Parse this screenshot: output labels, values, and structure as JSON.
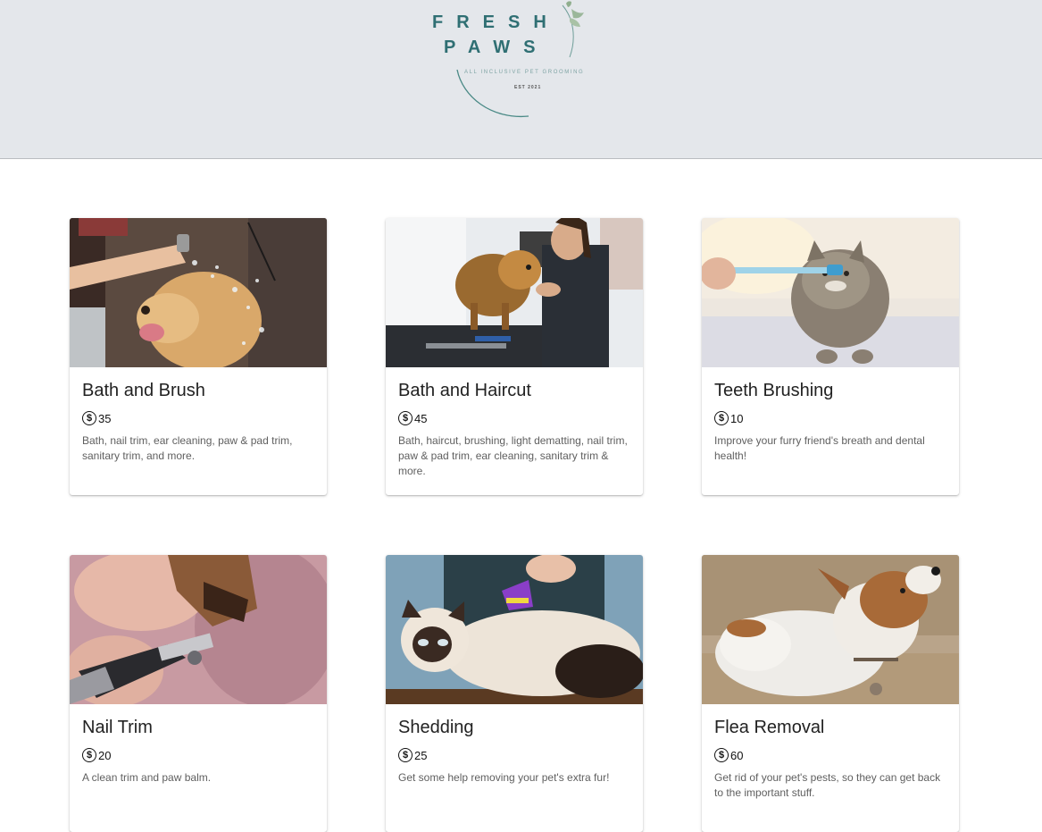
{
  "header": {
    "logo": {
      "line1": "FRESH",
      "line2": "PAWS",
      "tagline": "All inclusive pet grooming",
      "est": "EST 2021"
    },
    "background": "#e4e7eb",
    "brand_color": "#2f6f73"
  },
  "services": [
    {
      "title": "Bath and Brush",
      "price": "35",
      "description": "Bath, nail trim, ear cleaning, paw & pad trim, sanitary trim, and more.",
      "image": "dog-bath-photo"
    },
    {
      "title": "Bath and Haircut",
      "price": "45",
      "description": "Bath, haircut, brushing, light dematting, nail trim, paw & pad trim, ear cleaning, sanitary trim & more.",
      "image": "pomeranian-grooming-photo"
    },
    {
      "title": "Teeth Brushing",
      "price": "10",
      "description": "Improve your furry friend's breath and dental health!",
      "image": "cat-toothbrush-photo"
    },
    {
      "title": "Nail Trim",
      "price": "20",
      "description": "A clean trim and paw balm.",
      "image": "nail-clipper-photo"
    },
    {
      "title": "Shedding",
      "price": "25",
      "description": "Get some help removing your pet's extra fur!",
      "image": "cat-deshedding-photo"
    },
    {
      "title": "Flea Removal",
      "price": "60",
      "description": "Get rid of your pet's pests, so they can get back to the important stuff.",
      "image": "terrier-scratching-photo"
    }
  ],
  "icons": {
    "price": "dollar-circle-icon",
    "dollar_glyph": "$"
  }
}
